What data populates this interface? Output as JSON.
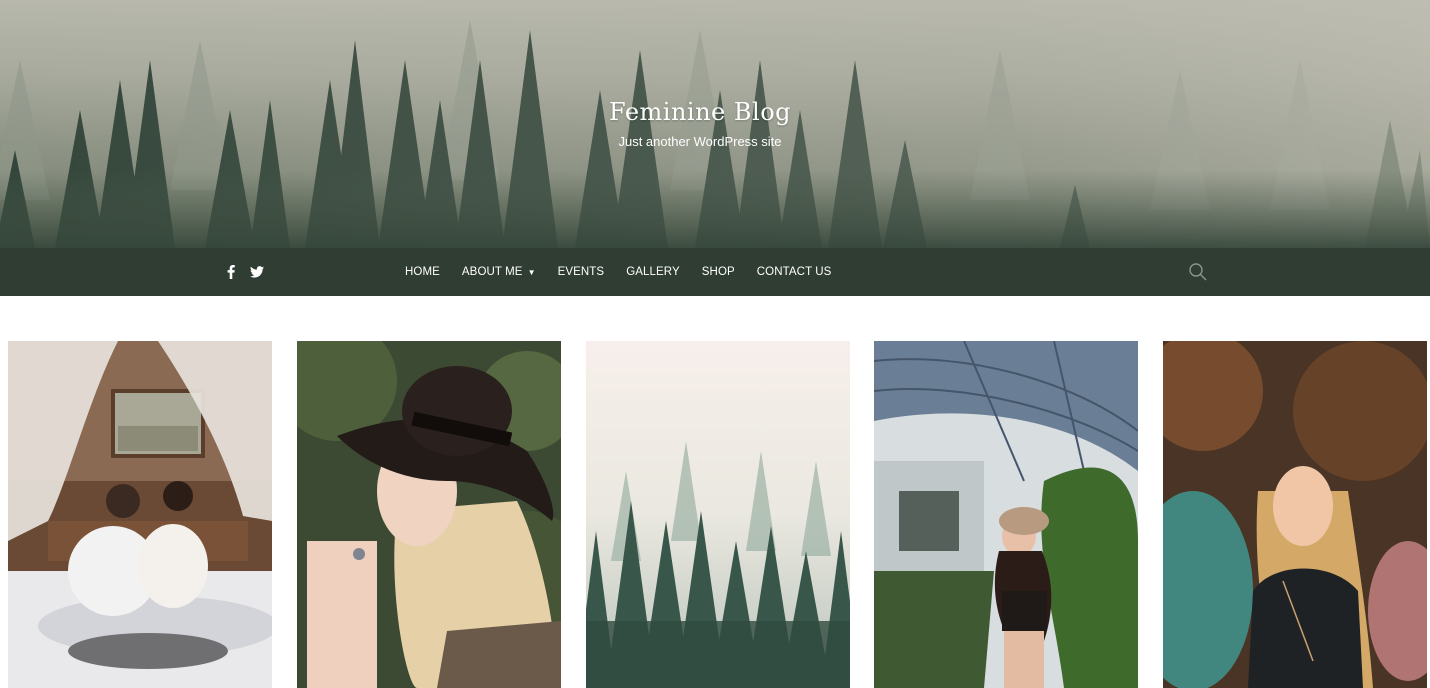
{
  "site": {
    "title": "Feminine Blog",
    "tagline": "Just another WordPress site"
  },
  "social": [
    {
      "icon": "facebook-icon",
      "glyph": "f"
    },
    {
      "icon": "twitter-icon",
      "glyph": "bird"
    }
  ],
  "menu": [
    {
      "label": "HOME"
    },
    {
      "label": "ABOUT ME",
      "has_dropdown": true
    },
    {
      "label": "EVENTS"
    },
    {
      "label": "GALLERY"
    },
    {
      "label": "SHOP"
    },
    {
      "label": "CONTACT US"
    }
  ],
  "search": {
    "icon": "search-icon"
  },
  "colors": {
    "navbar": "#2f3d33",
    "text_light": "#ffffff"
  },
  "gallery": [
    {
      "name": "couple-bed-photo"
    },
    {
      "name": "woman-hat-photo"
    },
    {
      "name": "misty-forest-photo"
    },
    {
      "name": "greenhouse-woman-photo"
    },
    {
      "name": "smoke-bomb-woman-photo"
    }
  ]
}
